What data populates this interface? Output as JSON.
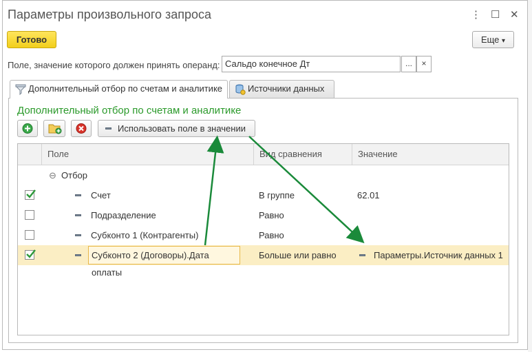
{
  "window": {
    "title": "Параметры произвольного запроса",
    "controls": {
      "menu": "⋮",
      "maximize": "☐",
      "close": "✕"
    }
  },
  "toolbar": {
    "ready_label": "Готово",
    "more_label": "Еще",
    "more_arrow": "▾"
  },
  "operand": {
    "label": "Поле, значение которого должен принять операнд:",
    "value": "Сальдо конечное Дт",
    "select_label": "...",
    "clear_label": "×"
  },
  "tabs": [
    {
      "label": "Дополнительный отбор по счетам и аналитике",
      "icon": "filter-icon",
      "active": true
    },
    {
      "label": "Источники данных",
      "icon": "database-icon",
      "active": false
    }
  ],
  "filter_panel": {
    "title": "Дополнительный отбор по счетам и аналитике",
    "use_field_label": "Использовать поле в значении"
  },
  "grid": {
    "columns": [
      "Поле",
      "Вид сравнения",
      "Значение"
    ],
    "group": {
      "label": "Отбор",
      "toggle": "⊖"
    },
    "rows": [
      {
        "checked": true,
        "field": "Счет",
        "comparison": "В группе",
        "value": "62.01",
        "value_is_field": false
      },
      {
        "checked": false,
        "field": "Подразделение",
        "comparison": "Равно",
        "value": "",
        "value_is_field": false
      },
      {
        "checked": false,
        "field": "Субконто 1 (Контрагенты)",
        "comparison": "Равно",
        "value": "",
        "value_is_field": false
      },
      {
        "checked": true,
        "field": "Субконто 2 (Договоры).Дата оплаты",
        "comparison": "Больше или равно",
        "value": "Параметры.Источник данных 1",
        "value_is_field": true
      }
    ]
  },
  "colors": {
    "accent_yellow": "#f5d422",
    "group_title_green": "#2b9a2b",
    "arrow_green": "#1a8a3a",
    "selected_row": "#fbeec4"
  }
}
